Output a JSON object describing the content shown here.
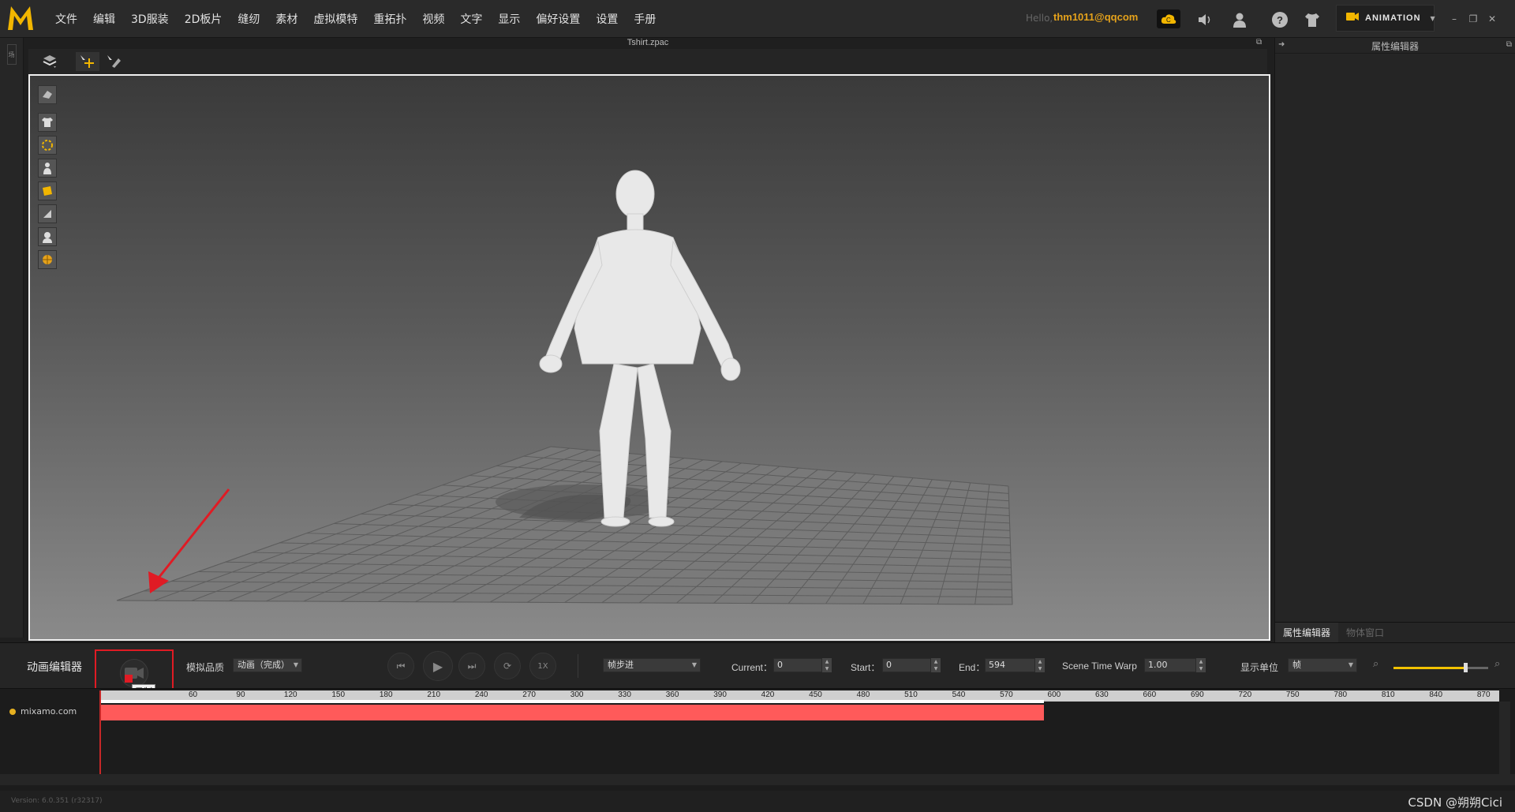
{
  "app": {
    "logo": "MD",
    "hello": "Hello,",
    "user": "thm1011@qqcom",
    "mode": "ANIMATION",
    "menu": [
      "文件",
      "编辑",
      "3D服装",
      "2D板片",
      "缝纫",
      "素材",
      "虚拟模特",
      "重拓扑",
      "视频",
      "文字",
      "显示",
      "偏好设置",
      "设置",
      "手册"
    ]
  },
  "viewport": {
    "file_title": "Tshirt.zpac",
    "left_tab": "场"
  },
  "right_panel": {
    "title": "属性编辑器",
    "tabs": [
      "属性编辑器",
      "物体窗口"
    ]
  },
  "anim_editor": {
    "title": "动画编辑器",
    "record_tooltip": "录制",
    "quality_label": "模拟品质",
    "quality_value": "动画（完成）",
    "step_value": "帧步进",
    "speed_label": "1X",
    "current_label": "Current：",
    "current_value": "0",
    "start_label": "Start：",
    "start_value": "0",
    "end_label": "End：",
    "end_value": "594",
    "warp_label": "Scene Time Warp",
    "warp_value": "1.00",
    "unit_label": "显示单位",
    "unit_value": "帧",
    "zoom_level": 0.76
  },
  "timeline": {
    "track_name": "mixamo.com",
    "frames": {
      "start": 0,
      "end": 594,
      "visible_max": 880
    },
    "ticks": [
      "60",
      "90",
      "120",
      "150",
      "180",
      "210",
      "240",
      "270",
      "300",
      "330",
      "360",
      "390",
      "420",
      "450",
      "480",
      "510",
      "540",
      "570",
      "600",
      "630",
      "660",
      "690",
      "720",
      "750",
      "780",
      "810",
      "840",
      "870"
    ]
  },
  "status": {
    "version": "Version: 6.0.351 (r32317)",
    "watermark": "CSDN @朔朔Cici"
  },
  "colors": {
    "accent": "#e5a21b",
    "clip": "#ff5a5a",
    "record": "#e01b24"
  }
}
